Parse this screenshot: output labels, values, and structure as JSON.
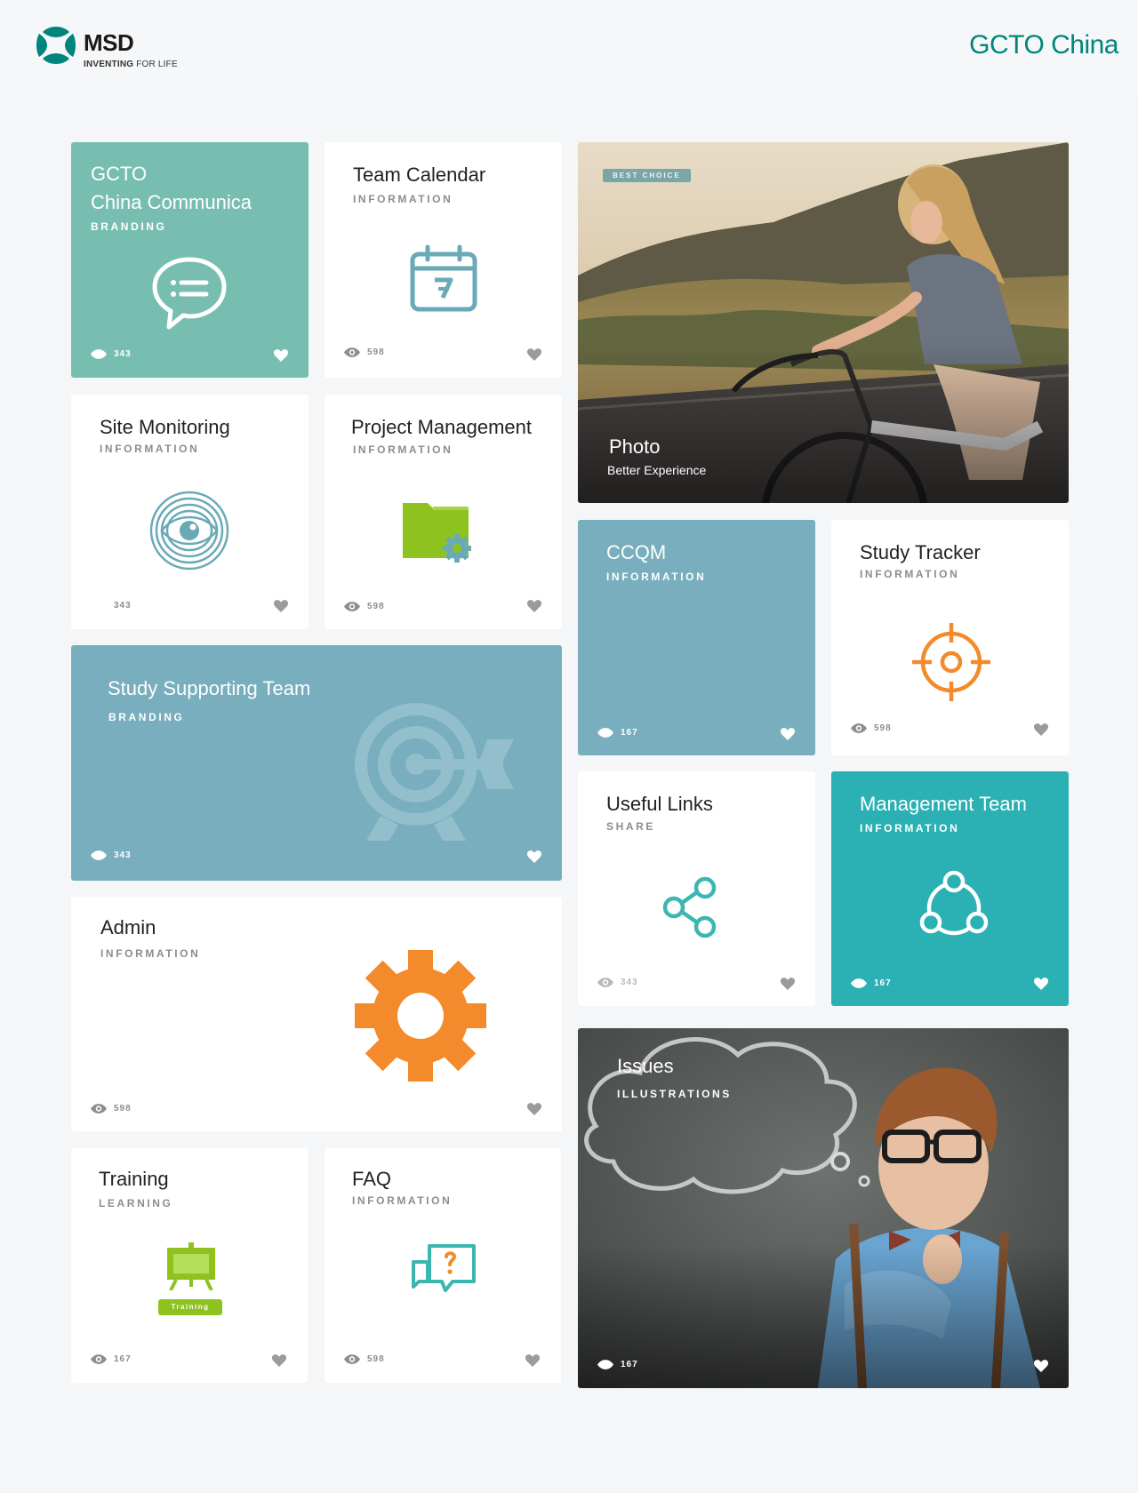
{
  "header": {
    "logo_name": "MSD",
    "logo_tag_bold": "INVENTING",
    "logo_tag_thin": "FOR LIFE",
    "brand_title": "GCTO China"
  },
  "colors": {
    "brand_green": "#00857c",
    "mint": "#78beb0",
    "slate_blue": "#78aebd",
    "teal": "#2bb1b3",
    "orange": "#f38a2c",
    "lime": "#8dc21f"
  },
  "tiles": {
    "gcto": {
      "title_line1": "GCTO",
      "title_line2": "China Communica",
      "category": "BRANDING",
      "views": "343",
      "icon": "chat-bubble-icon"
    },
    "calendar": {
      "title": "Team Calendar",
      "category": "INFORMATION",
      "views": "598",
      "icon": "calendar-icon"
    },
    "photo": {
      "badge": "BEST CHOICE",
      "title": "Photo",
      "subtitle": "Better Experience"
    },
    "site_monitoring": {
      "title": "Site Monitoring",
      "category": "INFORMATION",
      "views": "343",
      "icon": "eye-fingerprint-icon"
    },
    "project_management": {
      "title": "Project Management",
      "category": "INFORMATION",
      "views": "598",
      "icon": "folder-gear-icon"
    },
    "ccqm": {
      "title": "CCQM",
      "category": "INFORMATION",
      "views": "167"
    },
    "study_tracker": {
      "title": "Study Tracker",
      "category": "INFORMATION",
      "views": "598",
      "icon": "crosshair-icon"
    },
    "study_supporting": {
      "title": "Study Supporting Team",
      "category": "BRANDING",
      "views": "343",
      "icon": "target-arrow-icon"
    },
    "useful_links": {
      "title": "Useful Links",
      "category": "SHARE",
      "views": "343",
      "icon": "share-icon"
    },
    "management_team": {
      "title": "Management Team",
      "category": "INFORMATION",
      "views": "167",
      "icon": "team-network-icon"
    },
    "admin": {
      "title": "Admin",
      "category": "INFORMATION",
      "views": "598",
      "icon": "gear-icon"
    },
    "issues": {
      "title": "Issues",
      "category": "ILLUSTRATIONS",
      "views": "167"
    },
    "training": {
      "title": "Training",
      "category": "LEARNING",
      "views": "167",
      "icon": "training-board-icon",
      "board_label": "Training"
    },
    "faq": {
      "title": "FAQ",
      "category": "INFORMATION",
      "views": "598",
      "icon": "faq-chat-icon"
    }
  }
}
